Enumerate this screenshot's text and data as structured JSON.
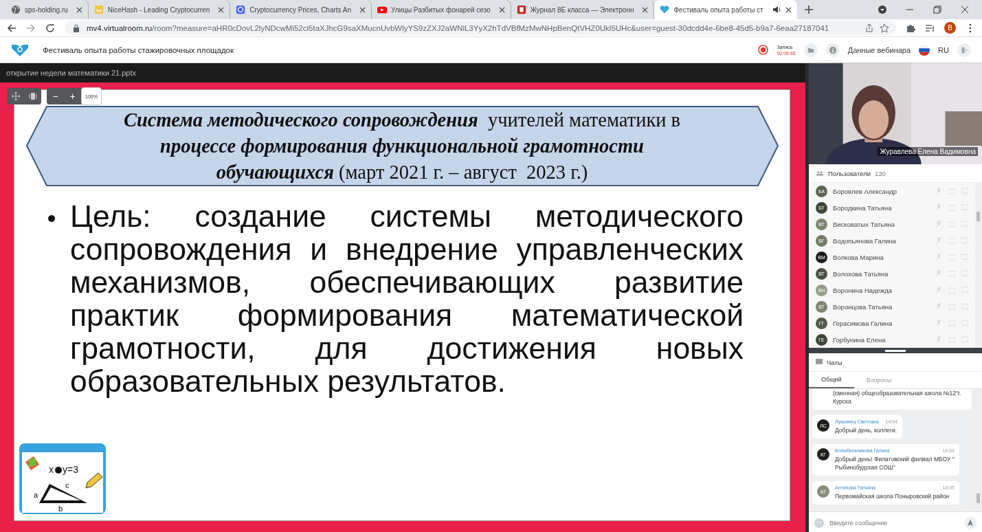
{
  "browser": {
    "tabs": [
      {
        "title": "sps-holding.ru",
        "kind": "globe",
        "selected": false
      },
      {
        "title": "NiceHash - Leading Cryptocurren",
        "kind": "smile",
        "selected": false
      },
      {
        "title": "Cryptocurrency Prices, Charts An",
        "kind": "coin",
        "selected": false
      },
      {
        "title": "Улицы Разбитых фонарей сезо",
        "kind": "video",
        "selected": false
      },
      {
        "title": "Журнал 8Е класса — Электронн",
        "kind": "book",
        "selected": false
      },
      {
        "title": "Фестиваль опыта работы ст",
        "kind": "heart",
        "selected": true,
        "audio": true
      }
    ],
    "url_host": "mv4.virtualroom.ru",
    "url_rest": "/room?measure=aHR0cDovL2lyNDcwMi52ci5taXJhcG9saXMucnUvbWlyYS9zZXJ2aWNlL3YyX2hTdVBfMzMwNHpBenQtVHZ0Ukl5UHc&user=guest-30dcdd4e-6be8-45d5-b9a7-6eaa27187041",
    "profile_initial": "В"
  },
  "header": {
    "title": "Фестиваль опыта работы стажировочных площадок",
    "record_label": "Запись",
    "record_time": "00:06:45",
    "webinar_info": "Данные вебинара",
    "language": "RU"
  },
  "presentation": {
    "file_name": "открытие недели математики 21.pptx",
    "zoom": "100%",
    "zoom_out": "−",
    "zoom_in": "+",
    "banner": "**Система методического сопровождения**  учителей математики в **процессе формирования функциональной грамотности обучающихся** (март 2021 г. – август  2023 г.)",
    "bullet": "Цель: создание системы методического сопровождения и внедрение управленческих механизмов, обеспечивающих развитие практик формирования математической грамотности, для достижения новых образовательных результатов.",
    "clipart": {
      "formula_left": "x",
      "formula_right": "y=3",
      "side_labels": [
        "a",
        "c",
        "b"
      ]
    }
  },
  "webcam": {
    "name": "Журавлева Елена Вадимовна"
  },
  "users": {
    "title": "Пользователи",
    "count": "130",
    "items": [
      {
        "initials": "БА",
        "name": "Боровлев Александр",
        "color": "#5c6352"
      },
      {
        "initials": "БТ",
        "name": "Бородкина Татьяна",
        "color": "#3f4639"
      },
      {
        "initials": "ВТ",
        "name": "Висковатых Татьяна",
        "color": "#7d8470"
      },
      {
        "initials": "ВГ",
        "name": "Водопьянова Галина",
        "color": "#747b67"
      },
      {
        "initials": "ВМ",
        "name": "Волкова Марина",
        "color": "#1c1c1c"
      },
      {
        "initials": "ВТ",
        "name": "Волохова Татьяна",
        "color": "#4b5244"
      },
      {
        "initials": "ВН",
        "name": "Воронина Надежда",
        "color": "#959c87"
      },
      {
        "initials": "ВТ",
        "name": "Воронцова Татьяна",
        "color": "#7d8470"
      },
      {
        "initials": "ГГ",
        "name": "Герасимова Галина",
        "color": "#555c4b"
      },
      {
        "initials": "ГЕ",
        "name": "Горбунина Елена",
        "color": "#3f4639"
      }
    ]
  },
  "chat": {
    "title": "Чаты",
    "tabs": [
      {
        "label": "Общий",
        "selected": true
      },
      {
        "label": "Вопросы",
        "selected": false
      }
    ],
    "messages": [
      {
        "kind": "fragment",
        "text": "(сменная) общеобразовательная школа №12\"г. Курска"
      },
      {
        "kind": "message",
        "initials": "ЛС",
        "color": "#1f211d",
        "author": "Лукьянец Светлана",
        "time": "14:04",
        "text": "Добрый день, коллеги."
      },
      {
        "kind": "message",
        "initials": "КГ",
        "color": "#1f211d",
        "author": "Колыбельникова Галина",
        "time": "14:04",
        "text": "Добрый день! Филатовский филиал МБОУ \" Рыбинобудская СОШ\""
      },
      {
        "kind": "message",
        "initials": "АТ",
        "color": "#868d79",
        "author": "Антипова Татьяна",
        "time": "14:05",
        "text": "Первомайская школа Поныровский район"
      }
    ],
    "input_placeholder": "Введите сообщение"
  }
}
